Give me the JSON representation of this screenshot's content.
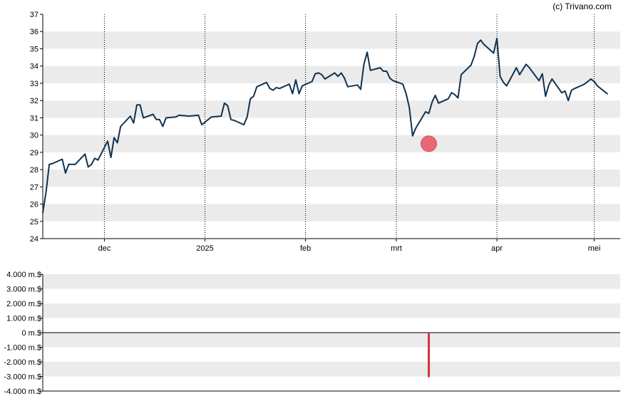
{
  "credit": "(c) Trivano.com",
  "colors": {
    "line": "#12324f",
    "marker": "#e8535f",
    "bar": "#d6303e",
    "band": "#ebebeb",
    "axis": "#000000",
    "vgrid": "#000000"
  },
  "chart_data": [
    {
      "type": "line",
      "title": "",
      "xlabel": "",
      "ylabel": "",
      "ylim": [
        24,
        37
      ],
      "yticks": [
        "24",
        "25",
        "26",
        "27",
        "28",
        "29",
        "30",
        "31",
        "32",
        "33",
        "34",
        "35",
        "36",
        "37"
      ],
      "xlim": [
        "2024-11-12",
        "2025-05-09"
      ],
      "xticks": [
        {
          "label": "dec",
          "date": "2024-12-01"
        },
        {
          "label": "2025",
          "date": "2025-01-01"
        },
        {
          "label": "feb",
          "date": "2025-02-01"
        },
        {
          "label": "mrt",
          "date": "2025-03-01"
        },
        {
          "label": "apr",
          "date": "2025-04-01"
        },
        {
          "label": "mei",
          "date": "2025-05-01"
        }
      ],
      "grid": "alternating horizontal bands, dotted vertical lines at month ticks",
      "series": [
        {
          "values": [
            [
              "2024-11-12",
              25.5
            ],
            [
              "2024-11-13",
              26.7
            ],
            [
              "2024-11-14",
              28.3
            ],
            [
              "2024-11-15",
              28.35
            ],
            [
              "2024-11-18",
              28.6
            ],
            [
              "2024-11-19",
              27.8
            ],
            [
              "2024-11-20",
              28.3
            ],
            [
              "2024-11-21",
              28.3
            ],
            [
              "2024-11-22",
              28.3
            ],
            [
              "2024-11-25",
              28.9
            ],
            [
              "2024-11-26",
              28.15
            ],
            [
              "2024-11-27",
              28.3
            ],
            [
              "2024-11-28",
              28.65
            ],
            [
              "2024-11-29",
              28.55
            ],
            [
              "2024-12-02",
              29.65
            ],
            [
              "2024-12-03",
              28.7
            ],
            [
              "2024-12-04",
              29.85
            ],
            [
              "2024-12-05",
              29.55
            ],
            [
              "2024-12-06",
              30.5
            ],
            [
              "2024-12-09",
              31.1
            ],
            [
              "2024-12-10",
              30.7
            ],
            [
              "2024-12-11",
              31.75
            ],
            [
              "2024-12-12",
              31.75
            ],
            [
              "2024-12-13",
              31.0
            ],
            [
              "2024-12-16",
              31.2
            ],
            [
              "2024-12-17",
              30.9
            ],
            [
              "2024-12-18",
              30.9
            ],
            [
              "2024-12-19",
              30.5
            ],
            [
              "2024-12-20",
              31.0
            ],
            [
              "2024-12-23",
              31.05
            ],
            [
              "2024-12-24",
              31.15
            ],
            [
              "2024-12-27",
              31.1
            ],
            [
              "2024-12-30",
              31.15
            ],
            [
              "2024-12-31",
              30.6
            ],
            [
              "2025-01-02",
              30.9
            ],
            [
              "2025-01-03",
              31.05
            ],
            [
              "2025-01-06",
              31.1
            ],
            [
              "2025-01-07",
              31.85
            ],
            [
              "2025-01-08",
              31.7
            ],
            [
              "2025-01-09",
              30.9
            ],
            [
              "2025-01-10",
              30.85
            ],
            [
              "2025-01-13",
              30.6
            ],
            [
              "2025-01-14",
              31.05
            ],
            [
              "2025-01-15",
              32.1
            ],
            [
              "2025-01-16",
              32.25
            ],
            [
              "2025-01-17",
              32.8
            ],
            [
              "2025-01-20",
              33.05
            ],
            [
              "2025-01-21",
              32.7
            ],
            [
              "2025-01-22",
              32.6
            ],
            [
              "2025-01-23",
              32.75
            ],
            [
              "2025-01-24",
              32.7
            ],
            [
              "2025-01-27",
              32.95
            ],
            [
              "2025-01-28",
              32.4
            ],
            [
              "2025-01-29",
              33.2
            ],
            [
              "2025-01-30",
              32.4
            ],
            [
              "2025-01-31",
              32.85
            ],
            [
              "2025-02-03",
              33.1
            ],
            [
              "2025-02-04",
              33.55
            ],
            [
              "2025-02-05",
              33.6
            ],
            [
              "2025-02-06",
              33.5
            ],
            [
              "2025-02-07",
              33.25
            ],
            [
              "2025-02-10",
              33.6
            ],
            [
              "2025-02-11",
              33.4
            ],
            [
              "2025-02-12",
              33.6
            ],
            [
              "2025-02-13",
              33.3
            ],
            [
              "2025-02-14",
              32.8
            ],
            [
              "2025-02-17",
              32.9
            ],
            [
              "2025-02-18",
              32.65
            ],
            [
              "2025-02-19",
              34.1
            ],
            [
              "2025-02-20",
              34.8
            ],
            [
              "2025-02-21",
              33.75
            ],
            [
              "2025-02-24",
              33.9
            ],
            [
              "2025-02-25",
              33.7
            ],
            [
              "2025-02-26",
              33.7
            ],
            [
              "2025-02-27",
              33.3
            ],
            [
              "2025-02-28",
              33.15
            ],
            [
              "2025-03-03",
              32.95
            ],
            [
              "2025-03-04",
              32.4
            ],
            [
              "2025-03-05",
              31.6
            ],
            [
              "2025-03-06",
              29.95
            ],
            [
              "2025-03-07",
              30.4
            ],
            [
              "2025-03-10",
              31.35
            ],
            [
              "2025-03-11",
              31.25
            ],
            [
              "2025-03-12",
              31.9
            ],
            [
              "2025-03-13",
              32.3
            ],
            [
              "2025-03-14",
              31.85
            ],
            [
              "2025-03-17",
              32.1
            ],
            [
              "2025-03-18",
              32.45
            ],
            [
              "2025-03-19",
              32.35
            ],
            [
              "2025-03-20",
              32.15
            ],
            [
              "2025-03-21",
              33.5
            ],
            [
              "2025-03-24",
              34.05
            ],
            [
              "2025-03-25",
              34.55
            ],
            [
              "2025-03-26",
              35.3
            ],
            [
              "2025-03-27",
              35.5
            ],
            [
              "2025-03-28",
              35.25
            ],
            [
              "2025-03-31",
              34.75
            ],
            [
              "2025-04-01",
              35.6
            ],
            [
              "2025-04-02",
              33.4
            ],
            [
              "2025-04-03",
              33.05
            ],
            [
              "2025-04-04",
              32.85
            ],
            [
              "2025-04-07",
              33.9
            ],
            [
              "2025-04-08",
              33.5
            ],
            [
              "2025-04-09",
              33.8
            ],
            [
              "2025-04-10",
              34.1
            ],
            [
              "2025-04-11",
              33.9
            ],
            [
              "2025-04-14",
              33.15
            ],
            [
              "2025-04-15",
              33.55
            ],
            [
              "2025-04-16",
              32.25
            ],
            [
              "2025-04-17",
              32.9
            ],
            [
              "2025-04-18",
              33.25
            ],
            [
              "2025-04-21",
              32.45
            ],
            [
              "2025-04-22",
              32.55
            ],
            [
              "2025-04-23",
              32.0
            ],
            [
              "2025-04-24",
              32.6
            ],
            [
              "2025-04-25",
              32.7
            ],
            [
              "2025-04-28",
              32.95
            ],
            [
              "2025-04-29",
              33.1
            ],
            [
              "2025-04-30",
              33.25
            ],
            [
              "2025-05-01",
              33.1
            ],
            [
              "2025-05-02",
              32.85
            ],
            [
              "2025-05-05",
              32.4
            ]
          ]
        }
      ],
      "markers": [
        {
          "date": "2025-03-11",
          "value": 29.5,
          "shape": "circle"
        }
      ]
    },
    {
      "type": "bar",
      "title": "",
      "xlabel": "",
      "ylabel": "",
      "ylim": [
        -4000,
        4000
      ],
      "yticks": [
        "-4.000 m.$",
        "-3.000 m.$",
        "-2.000 m.$",
        "-1.000 m.$",
        "0 m.$",
        "1.000 m.$",
        "2.000 m.$",
        "3.000 m.$",
        "4.000 m.$"
      ],
      "ytick_values": [
        -4000,
        -3000,
        -2000,
        -1000,
        0,
        1000,
        2000,
        3000,
        4000
      ],
      "xlim": [
        "2024-11-12",
        "2025-05-09"
      ],
      "grid": "alternating horizontal bands",
      "bars": [
        {
          "date": "2025-03-11",
          "value": -3050
        }
      ]
    }
  ]
}
